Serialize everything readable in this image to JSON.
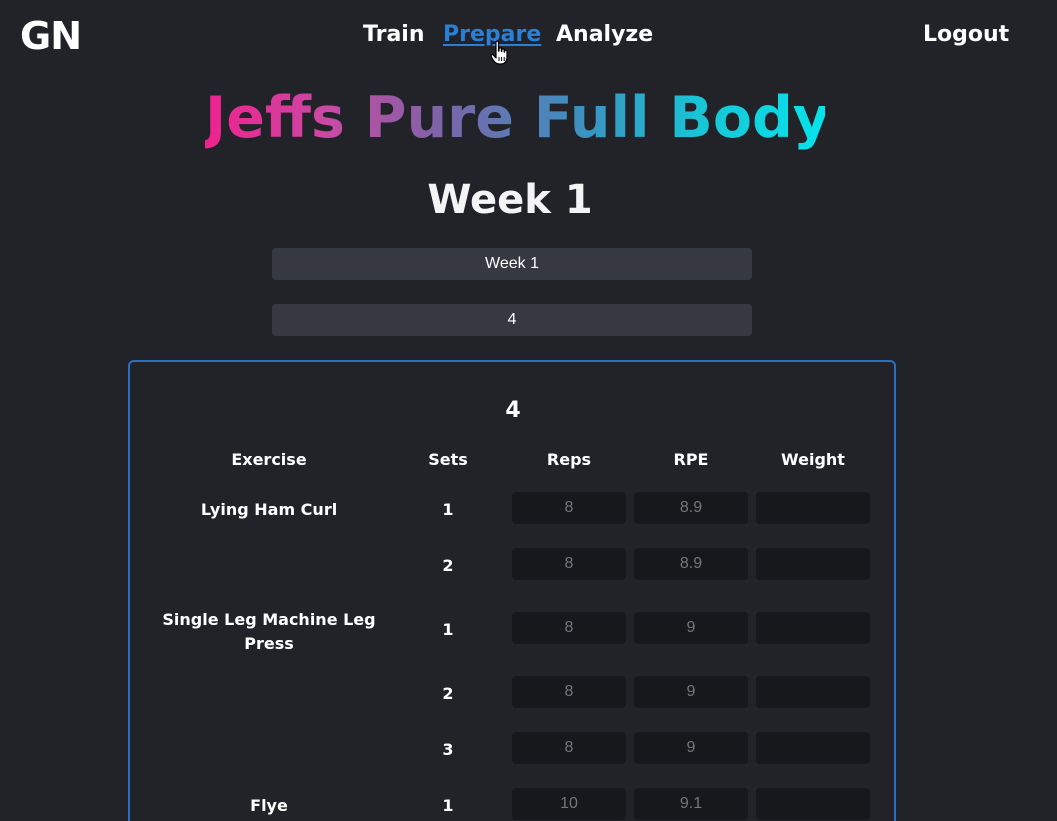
{
  "nav": {
    "logo": "GN",
    "links": [
      "Train",
      "Prepare",
      "Analyze"
    ],
    "active": "Prepare",
    "logout": "Logout"
  },
  "program": {
    "title": "Jeffs Pure Full Body"
  },
  "week": {
    "title": "Week 1",
    "name_value": "Week 1",
    "days_value": "4"
  },
  "day": {
    "title": "4",
    "columns": [
      "Exercise",
      "Sets",
      "Reps",
      "RPE",
      "Weight"
    ],
    "rows": [
      {
        "exercise": "Lying Ham Curl",
        "set": "1",
        "reps": "8",
        "rpe": "8.9",
        "weight": ""
      },
      {
        "exercise": "",
        "set": "2",
        "reps": "8",
        "rpe": "8.9",
        "weight": ""
      },
      {
        "exercise": "Single Leg Machine Leg Press",
        "set": "1",
        "reps": "8",
        "rpe": "9",
        "weight": ""
      },
      {
        "exercise": "",
        "set": "2",
        "reps": "8",
        "rpe": "9",
        "weight": ""
      },
      {
        "exercise": "",
        "set": "3",
        "reps": "8",
        "rpe": "9",
        "weight": ""
      },
      {
        "exercise": "Flye",
        "set": "1",
        "reps": "10",
        "rpe": "9.1",
        "weight": ""
      }
    ]
  },
  "colors": {
    "background": "#212328",
    "accent": "#2b7fd6",
    "card_border": "#2b6fc2",
    "title_gradient": [
      "#f0218f",
      "#7c64a8",
      "#06e4ec"
    ]
  }
}
